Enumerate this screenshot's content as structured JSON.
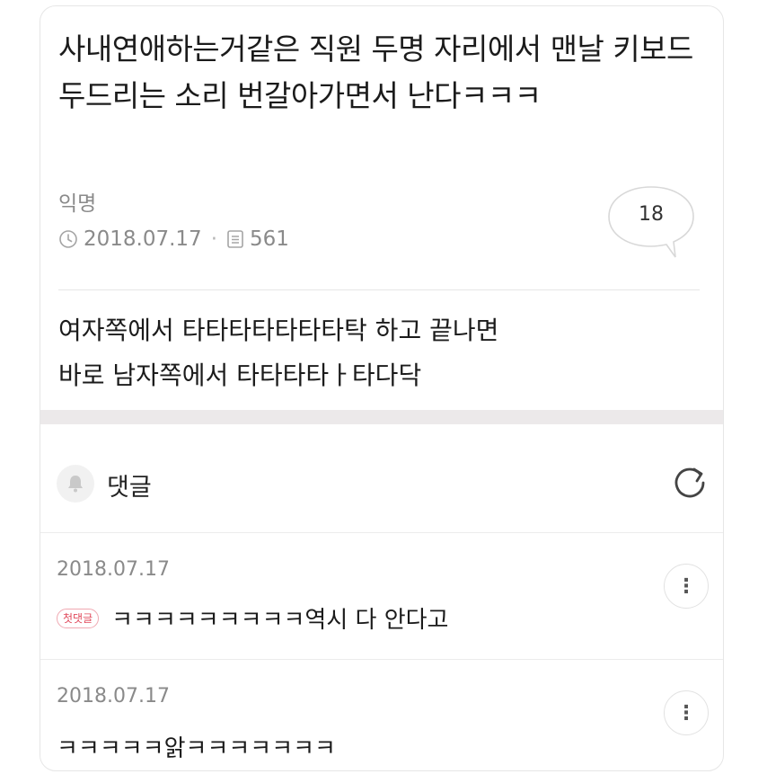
{
  "post": {
    "title": "사내연애하는거같은 직원 두명 자리에서 맨날 키보드 두드리는 소리 번갈아가면서 난다ㅋㅋㅋ",
    "author": "익명",
    "date": "2018.07.17",
    "views": "561",
    "comment_count": "18",
    "body_lines": [
      "여자쪽에서 타타타타타타타탁 하고 끝나면",
      "바로 남자쪽에서 타타타타ㅏ타다닥"
    ]
  },
  "comments_section": {
    "label": "댓글",
    "items": [
      {
        "date": "2018.07.17",
        "badge": "첫댓글",
        "text": "ㅋㅋㅋㅋㅋㅋㅋㅋㅋ역시 다 안다고"
      },
      {
        "date": "2018.07.17",
        "badge": "",
        "text": "ㅋㅋㅋㅋㅋ앍ㅋㅋㅋㅋㅋㅋㅋ"
      }
    ]
  },
  "icons": {
    "clock": "clock-icon",
    "views": "document-icon",
    "bubble": "speech-bubble-icon",
    "bell": "bell-icon",
    "refresh": "refresh-icon",
    "more": "more-vertical-icon"
  },
  "colors": {
    "badge": "#e0495b",
    "band": "#ece9ea"
  }
}
